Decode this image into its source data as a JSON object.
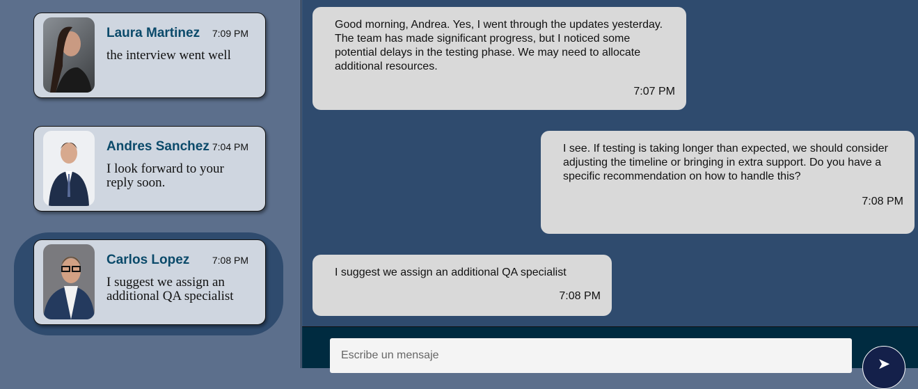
{
  "conversations": [
    {
      "name": "Laura Martinez",
      "time": "7:09 PM",
      "preview": "the interview went well"
    },
    {
      "name": "Andres Sanchez",
      "time": "7:04 PM",
      "preview": "I look forward to your reply soon."
    },
    {
      "name": "Carlos Lopez",
      "time": "7:08 PM",
      "preview": "I suggest we assign an additional QA specialist"
    }
  ],
  "messages": [
    {
      "text": "Good morning, Andrea. Yes, I went through the updates yesterday. The team has made significant progress, but I noticed some potential delays in the testing phase. We may need to allocate additional resources.",
      "time": "7:07 PM"
    },
    {
      "text": "I see. If testing is taking longer than expected, we should consider adjusting the timeline or bringing in extra support. Do you have a specific recommendation on how to handle this?",
      "time": "7:08 PM"
    },
    {
      "text": "I suggest we assign an additional QA specialist",
      "time": "7:08 PM"
    }
  ],
  "composer": {
    "placeholder": "Escribe un mensaje",
    "send_icon": "send-icon"
  }
}
